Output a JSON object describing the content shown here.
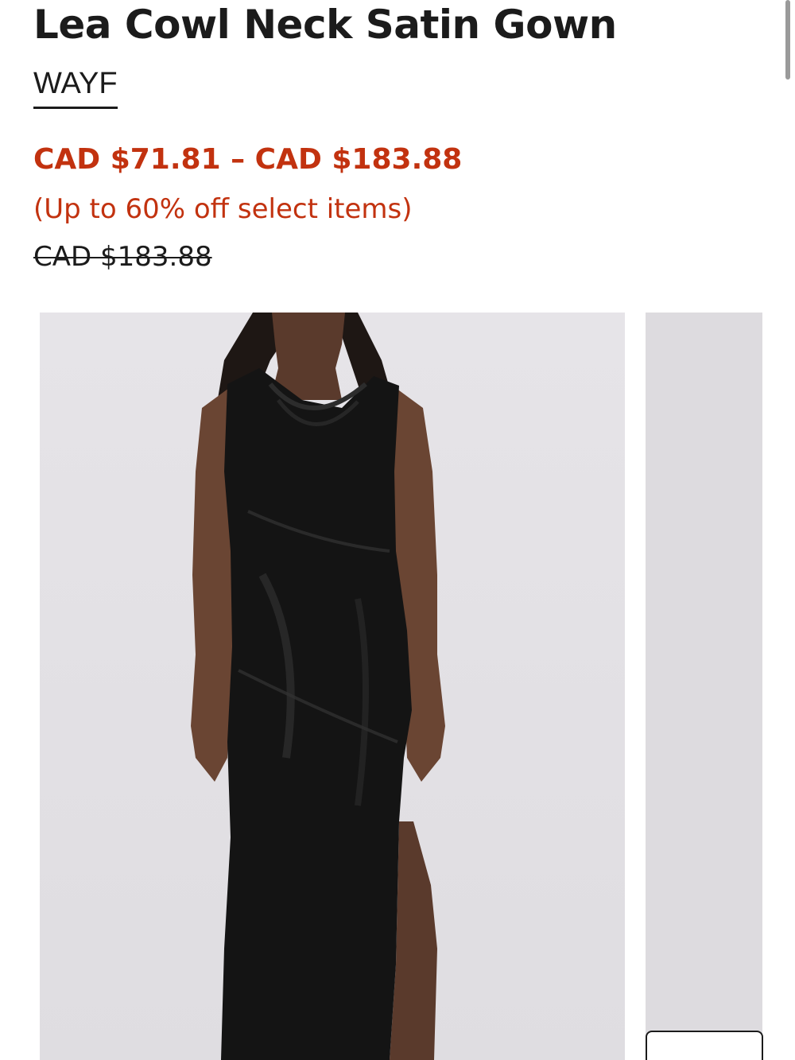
{
  "product": {
    "title": "Lea Cowl Neck Satin Gown",
    "brand": "WAYF",
    "price_range": "CAD $71.81 – CAD $183.88",
    "discount_note": "(Up to 60% off select items)",
    "original_price": "CAD $183.88"
  },
  "colors": {
    "sale": "#c2320f",
    "text": "#1b1b1b",
    "photo_bg": "#e2e0e4"
  },
  "gallery": {
    "main_image_alt": "Model wearing black cowl neck satin gown",
    "next_image_alt": "Next product image"
  }
}
